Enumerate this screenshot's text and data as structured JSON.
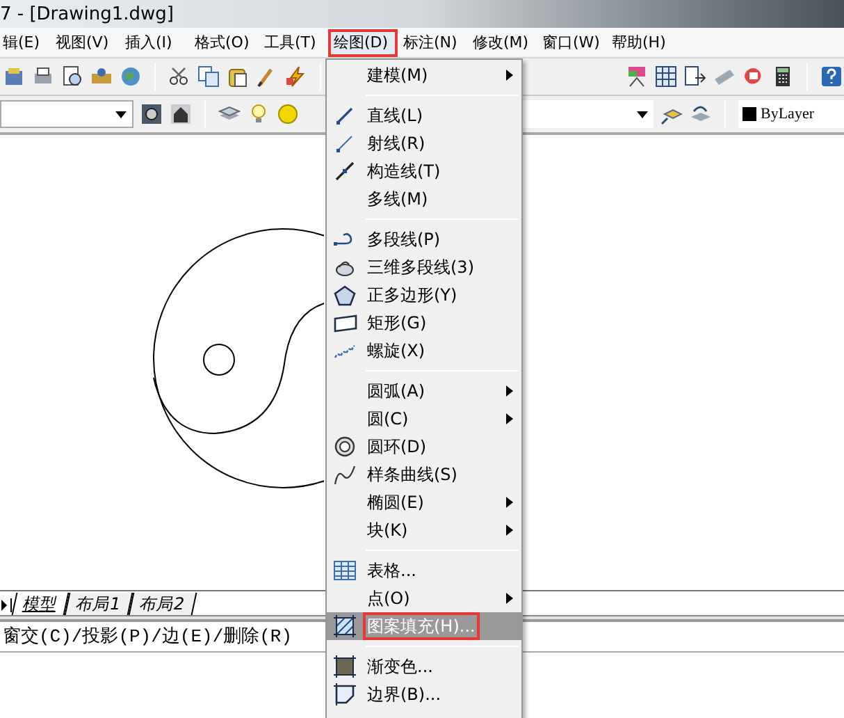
{
  "window": {
    "title": "7 - [Drawing1.dwg]"
  },
  "menubar": [
    {
      "label": "辑(E)",
      "selected": false,
      "highlighted": false
    },
    {
      "label": "视图(V)",
      "selected": false,
      "highlighted": false
    },
    {
      "label": "插入(I)",
      "selected": false,
      "highlighted": false
    },
    {
      "label": "格式(O)",
      "selected": false,
      "highlighted": false
    },
    {
      "label": "工具(T)",
      "selected": false,
      "highlighted": false
    },
    {
      "label": "绘图(D)",
      "selected": true,
      "highlighted": true
    },
    {
      "label": "标注(N)",
      "selected": false,
      "highlighted": false
    },
    {
      "label": "修改(M)",
      "selected": false,
      "highlighted": false
    },
    {
      "label": "窗口(W)",
      "selected": false,
      "highlighted": false
    },
    {
      "label": "帮助(H)",
      "selected": false,
      "highlighted": false
    }
  ],
  "properties_toolbar": {
    "linetype_value": "ByLayer"
  },
  "draw_menu": [
    {
      "kind": "item",
      "label": "建模(M)",
      "submenu": true,
      "selected": false,
      "highlighted": false
    },
    {
      "kind": "separator"
    },
    {
      "kind": "item",
      "label": "直线(L)",
      "submenu": false,
      "selected": false,
      "highlighted": false
    },
    {
      "kind": "item",
      "label": "射线(R)",
      "submenu": false,
      "selected": false,
      "highlighted": false
    },
    {
      "kind": "item",
      "label": "构造线(T)",
      "submenu": false,
      "selected": false,
      "highlighted": false
    },
    {
      "kind": "item",
      "label": "多线(M)",
      "submenu": false,
      "selected": false,
      "highlighted": false
    },
    {
      "kind": "separator"
    },
    {
      "kind": "item",
      "label": "多段线(P)",
      "submenu": false,
      "selected": false,
      "highlighted": false
    },
    {
      "kind": "item",
      "label": "三维多段线(3)",
      "submenu": false,
      "selected": false,
      "highlighted": false
    },
    {
      "kind": "item",
      "label": "正多边形(Y)",
      "submenu": false,
      "selected": false,
      "highlighted": false
    },
    {
      "kind": "item",
      "label": "矩形(G)",
      "submenu": false,
      "selected": false,
      "highlighted": false
    },
    {
      "kind": "item",
      "label": "螺旋(X)",
      "submenu": false,
      "selected": false,
      "highlighted": false
    },
    {
      "kind": "separator"
    },
    {
      "kind": "item",
      "label": "圆弧(A)",
      "submenu": true,
      "selected": false,
      "highlighted": false
    },
    {
      "kind": "item",
      "label": "圆(C)",
      "submenu": true,
      "selected": false,
      "highlighted": false
    },
    {
      "kind": "item",
      "label": "圆环(D)",
      "submenu": false,
      "selected": false,
      "highlighted": false
    },
    {
      "kind": "item",
      "label": "样条曲线(S)",
      "submenu": false,
      "selected": false,
      "highlighted": false
    },
    {
      "kind": "item",
      "label": "椭圆(E)",
      "submenu": true,
      "selected": false,
      "highlighted": false
    },
    {
      "kind": "item",
      "label": "块(K)",
      "submenu": true,
      "selected": false,
      "highlighted": false
    },
    {
      "kind": "separator"
    },
    {
      "kind": "item",
      "label": "表格...",
      "submenu": false,
      "selected": false,
      "highlighted": false
    },
    {
      "kind": "item",
      "label": "点(O)",
      "submenu": true,
      "selected": false,
      "highlighted": false
    },
    {
      "kind": "item",
      "label": "图案填充(H)...",
      "submenu": false,
      "selected": true,
      "highlighted": true
    },
    {
      "kind": "separator"
    },
    {
      "kind": "item",
      "label": "渐变色...",
      "submenu": false,
      "selected": false,
      "highlighted": false
    },
    {
      "kind": "item",
      "label": "边界(B)...",
      "submenu": false,
      "selected": false,
      "highlighted": false
    }
  ],
  "layout_tabs": [
    {
      "label": "模型",
      "selected": true
    },
    {
      "label": "布局1",
      "selected": false
    },
    {
      "label": "布局2",
      "selected": false
    }
  ],
  "command_line": {
    "text": "窗交(C)/投影(P)/边(E)/删除(R)"
  }
}
